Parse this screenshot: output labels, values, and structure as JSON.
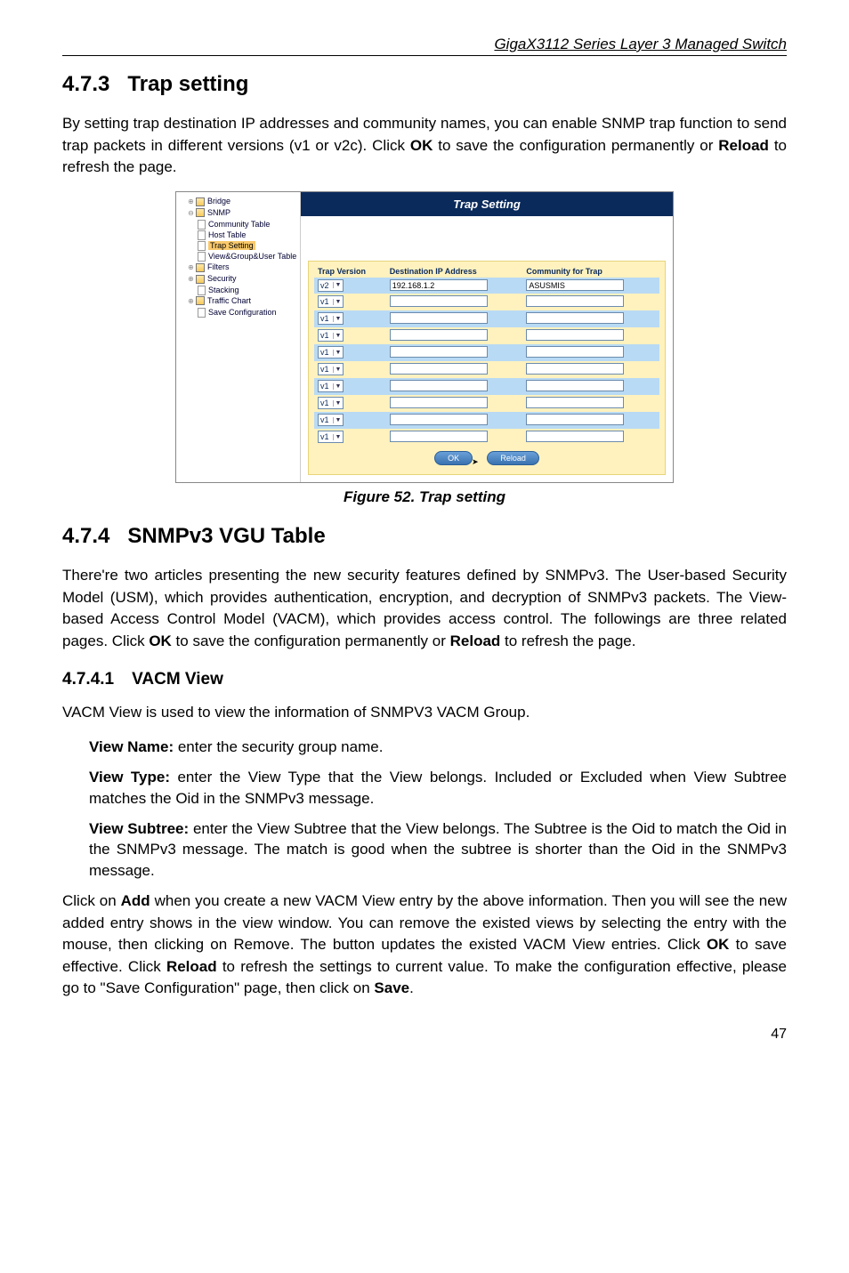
{
  "header": {
    "title": "GigaX3112 Series Layer 3 Managed Switch"
  },
  "s473": {
    "num": "4.7.3",
    "title": "Trap setting",
    "para": "By setting trap destination IP addresses and community names, you can enable SNMP trap function to send trap packets in different versions (v1 or v2c). Click OK to save the configuration permanently or Reload to refresh the page."
  },
  "figure": {
    "caption": "Figure 52. Trap setting"
  },
  "screenshot": {
    "titlebar": "Trap Setting",
    "tree": {
      "bridge": "Bridge",
      "snmp": "SNMP",
      "community": "Community Table",
      "host": "Host Table",
      "trap": "Trap Setting",
      "vgu": "View&Group&User Table",
      "filters": "Filters",
      "security": "Security",
      "stacking": "Stacking",
      "traffic": "Traffic Chart",
      "save": "Save Configuration"
    },
    "table": {
      "h1": "Trap Version",
      "h2": "Destination IP Address",
      "h3": "Community for Trap",
      "rows": [
        {
          "ver": "v2",
          "ip": "192.168.1.2",
          "comm": "ASUSMIS"
        },
        {
          "ver": "v1",
          "ip": "",
          "comm": ""
        },
        {
          "ver": "v1",
          "ip": "",
          "comm": ""
        },
        {
          "ver": "v1",
          "ip": "",
          "comm": ""
        },
        {
          "ver": "v1",
          "ip": "",
          "comm": ""
        },
        {
          "ver": "v1",
          "ip": "",
          "comm": ""
        },
        {
          "ver": "v1",
          "ip": "",
          "comm": ""
        },
        {
          "ver": "v1",
          "ip": "",
          "comm": ""
        },
        {
          "ver": "v1",
          "ip": "",
          "comm": ""
        },
        {
          "ver": "v1",
          "ip": "",
          "comm": ""
        }
      ],
      "ok": "OK",
      "reload": "Reload"
    }
  },
  "s474": {
    "num": "4.7.4",
    "title": "SNMPv3 VGU Table",
    "para": "There're two articles presenting the new security features defined by SNMPv3. The User-based Security Model (USM), which provides authentication, encryption, and decryption of SNMPv3 packets. The View-based Access Control Model (VACM), which provides access control. The followings are three related pages. Click OK to save the configuration permanently or Reload to refresh the page."
  },
  "s4741": {
    "num": "4.7.4.1",
    "title": "VACM View",
    "intro": "VACM View is used to view the information of SNMPV3 VACM Group.",
    "viewname": "View Name: enter the security group name.",
    "viewtype": "View Type: enter the View Type that the View belongs. Included or Excluded when View Subtree matches the Oid in the SNMPv3 message.",
    "viewsubtree": "View Subtree: enter the View Subtree that the View belongs. The Subtree is the Oid to match the Oid in the SNMPv3 message. The match is good when the subtree is shorter than the Oid in the SNMPv3 message.",
    "closing": "Click on Add when you create a new VACM View entry by the above information. Then you will see the new added entry shows in the view window. You can remove the existed views by selecting the entry with the mouse, then clicking on Remove. The  button updates the existed VACM View entries. Click OK to save effective. Click Reload to refresh the settings to current value. To make the configuration effective, please go to \"Save Configuration\" page, then click on Save."
  },
  "pagenum": "47"
}
